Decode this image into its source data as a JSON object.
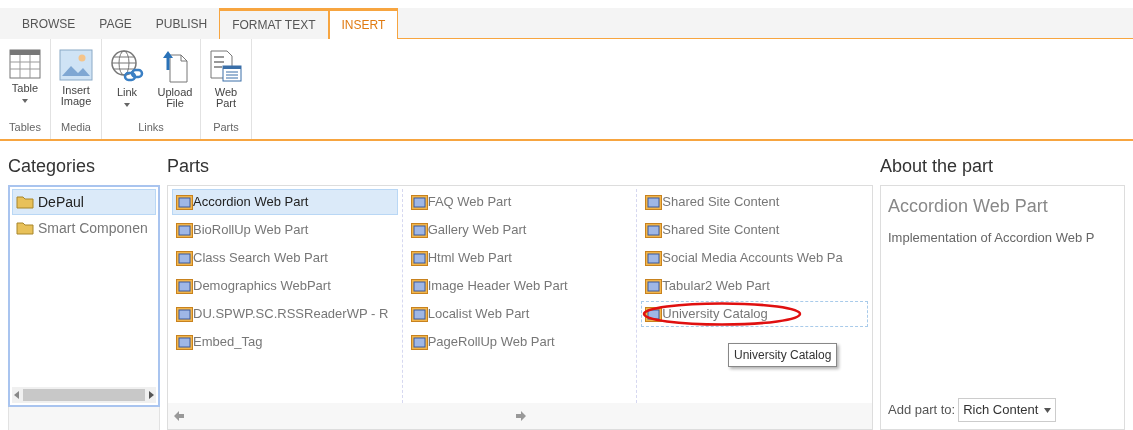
{
  "ribbon_tabs": [
    {
      "label": "BROWSE",
      "selected": false,
      "contextual": false
    },
    {
      "label": "PAGE",
      "selected": false,
      "contextual": false
    },
    {
      "label": "PUBLISH",
      "selected": false,
      "contextual": false
    },
    {
      "label": "FORMAT TEXT",
      "selected": false,
      "contextual": true
    },
    {
      "label": "INSERT",
      "selected": true,
      "contextual": true
    }
  ],
  "ribbon_groups": [
    {
      "label": "Tables",
      "buttons": [
        {
          "kind": "table",
          "label": "Table",
          "dropdown": true
        }
      ]
    },
    {
      "label": "Media",
      "buttons": [
        {
          "kind": "image",
          "label": "Insert Image",
          "dropdown": false
        }
      ]
    },
    {
      "label": "Links",
      "buttons": [
        {
          "kind": "link",
          "label": "Link",
          "dropdown": true
        },
        {
          "kind": "upload",
          "label": "Upload File",
          "dropdown": false
        }
      ]
    },
    {
      "label": "Parts",
      "buttons": [
        {
          "kind": "webpart",
          "label": "Web Part",
          "dropdown": false
        }
      ]
    }
  ],
  "categories": {
    "title": "Categories",
    "items": [
      {
        "label": "DePaul",
        "selected": true
      },
      {
        "label": "Smart Componen",
        "selected": false
      }
    ]
  },
  "parts": {
    "title": "Parts",
    "columns": [
      [
        {
          "label": "Accordion Web Part",
          "selected": true,
          "circled": false
        },
        {
          "label": "BioRollUp Web Part",
          "selected": false,
          "circled": false
        },
        {
          "label": "Class Search Web Part",
          "selected": false,
          "circled": false
        },
        {
          "label": "Demographics WebPart",
          "selected": false,
          "circled": false
        },
        {
          "label": "DU.SPWP.SC.RSSReaderWP - R",
          "selected": false,
          "circled": false
        },
        {
          "label": "Embed_Tag",
          "selected": false,
          "circled": false
        }
      ],
      [
        {
          "label": "FAQ Web Part",
          "selected": false,
          "circled": false
        },
        {
          "label": "Gallery Web Part",
          "selected": false,
          "circled": false
        },
        {
          "label": "Html Web Part",
          "selected": false,
          "circled": false
        },
        {
          "label": "Image Header Web Part",
          "selected": false,
          "circled": false
        },
        {
          "label": "Localist Web Part",
          "selected": false,
          "circled": false
        },
        {
          "label": "PageRollUp Web Part",
          "selected": false,
          "circled": false
        }
      ],
      [
        {
          "label": "Shared Site Content",
          "selected": false,
          "circled": false
        },
        {
          "label": "Shared Site Content",
          "selected": false,
          "circled": false
        },
        {
          "label": "Social Media Accounts Web Pa",
          "selected": false,
          "circled": false
        },
        {
          "label": "Tabular2 Web Part",
          "selected": false,
          "circled": false
        },
        {
          "label": "University Catalog",
          "selected": false,
          "circled": true
        }
      ]
    ],
    "tooltip": "University Catalog"
  },
  "about": {
    "title": "About the part",
    "part_name": "Accordion Web Part",
    "description": "Implementation of Accordion Web P",
    "add_label": "Add part to:",
    "add_value": "Rich Content"
  }
}
